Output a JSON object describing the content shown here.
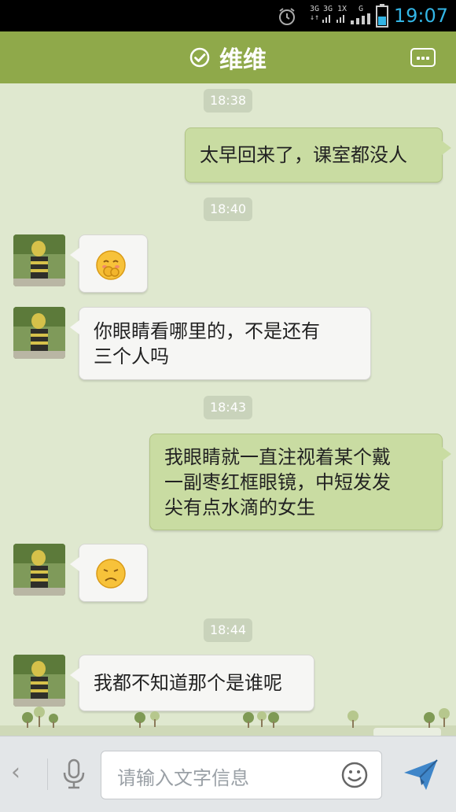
{
  "status_bar": {
    "network_labels": [
      "3G",
      "3G",
      "1X",
      "G"
    ],
    "time": "19:07"
  },
  "header": {
    "contact_name": "维维",
    "verified_icon": "check-circle-icon",
    "menu_icon": "more-icon"
  },
  "messages": [
    {
      "type": "timestamp",
      "text": "18:38"
    },
    {
      "type": "sent",
      "text": "太早回来了，课室都没人"
    },
    {
      "type": "timestamp",
      "text": "18:40"
    },
    {
      "type": "received",
      "emoji": "shy-face-emoji"
    },
    {
      "type": "received",
      "text_lines": [
        "你眼睛看哪里的，不是还有",
        "三个人吗"
      ]
    },
    {
      "type": "timestamp",
      "text": "18:43"
    },
    {
      "type": "sent",
      "text_lines": [
        "我眼睛就一直注视着某个戴",
        "一副枣红框眼镜，中短发发",
        "尖有点水滴的女生"
      ]
    },
    {
      "type": "received",
      "emoji": "sad-face-emoji"
    },
    {
      "type": "timestamp",
      "text": "18:44"
    },
    {
      "type": "received",
      "text": "我都不知道那个是谁呢"
    }
  ],
  "input_bar": {
    "back_glyph": "‹",
    "placeholder": "请输入文字信息",
    "mic_icon": "microphone-icon",
    "emoji_icon": "smiley-icon",
    "send_icon": "send-icon"
  },
  "colors": {
    "header": "#8fa94a",
    "background": "#dfe8cf",
    "sent_bubble": "#c9dca2",
    "received_bubble": "#f6f6f4",
    "time": "#33b5e5"
  }
}
